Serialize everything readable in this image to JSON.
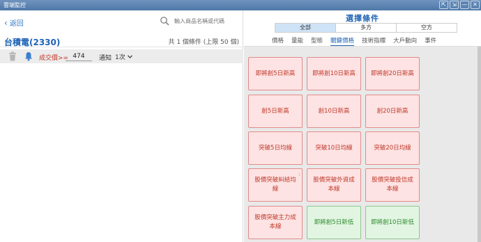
{
  "window": {
    "title": "雲端監控",
    "controls": [
      "⇱",
      "⇲",
      "—",
      "✕"
    ]
  },
  "left": {
    "back_label": "返回",
    "search_placeholder": "輸入商品名稱或代碼",
    "stock_title": "台積電(2330)",
    "count_text": "共 1 個條件 (上限 50 個)",
    "condition": {
      "label": "成交價>=",
      "value": "474",
      "notify_label": "通知",
      "notify_value": "1次"
    }
  },
  "right": {
    "title": "選擇條件",
    "segments": [
      {
        "label": "全部",
        "active": true
      },
      {
        "label": "多方",
        "active": false
      },
      {
        "label": "空方",
        "active": false
      }
    ],
    "tabs": [
      {
        "label": "價格",
        "active": false
      },
      {
        "label": "量能",
        "active": false
      },
      {
        "label": "型態",
        "active": false
      },
      {
        "label": "關鍵價格",
        "active": true
      },
      {
        "label": "技術指標",
        "active": false
      },
      {
        "label": "大戶動向",
        "active": false
      },
      {
        "label": "事件",
        "active": false
      }
    ],
    "tiles": [
      {
        "label": "即將創5日新高",
        "color": "red"
      },
      {
        "label": "即將創10日新高",
        "color": "red"
      },
      {
        "label": "即將創20日新高",
        "color": "red"
      },
      {
        "label": "創5日新高",
        "color": "red"
      },
      {
        "label": "創10日新高",
        "color": "red"
      },
      {
        "label": "創20日新高",
        "color": "red"
      },
      {
        "label": "突破5日均線",
        "color": "red"
      },
      {
        "label": "突破10日均線",
        "color": "red"
      },
      {
        "label": "突破20日均線",
        "color": "red"
      },
      {
        "label": "股價突破糾結均線",
        "color": "red",
        "info": true
      },
      {
        "label": "股價突破外資成本線",
        "color": "red"
      },
      {
        "label": "股價突破投信成本線",
        "color": "red"
      },
      {
        "label": "股價突破主力成本線",
        "color": "red"
      },
      {
        "label": "即將創5日新低",
        "color": "green"
      },
      {
        "label": "即將創10日新低",
        "color": "green"
      }
    ]
  }
}
